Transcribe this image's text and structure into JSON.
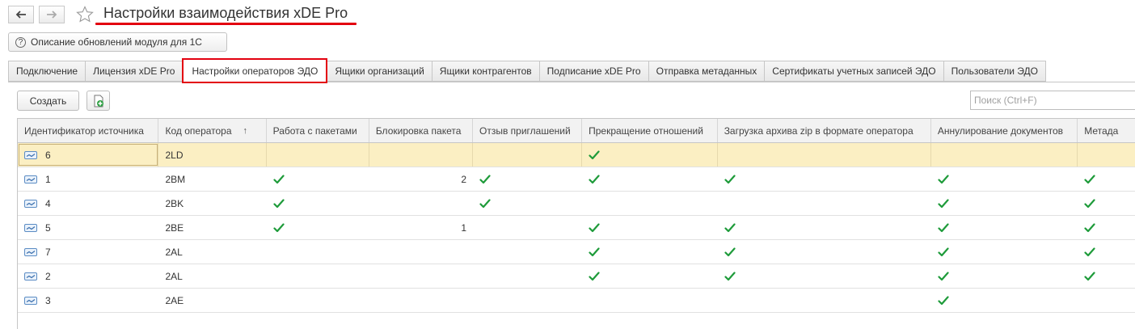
{
  "window": {
    "title": "Настройки взаимодействия xDE Pro",
    "nav": {
      "back_icon": "arrow-left-icon",
      "forward_icon": "arrow-right-icon",
      "favorite_icon": "star-icon"
    }
  },
  "toolbar": {
    "help_button_label": "Описание обновлений модуля для 1С"
  },
  "tabs": [
    {
      "label": "Подключение",
      "active": false
    },
    {
      "label": "Лицензия xDE Pro",
      "active": false
    },
    {
      "label": "Настройки операторов ЭДО",
      "active": true
    },
    {
      "label": "Ящики организаций",
      "active": false
    },
    {
      "label": "Ящики контрагентов",
      "active": false
    },
    {
      "label": "Подписание xDE Pro",
      "active": false
    },
    {
      "label": "Отправка метаданных",
      "active": false
    },
    {
      "label": "Сертификаты учетных записей ЭДО",
      "active": false
    },
    {
      "label": "Пользователи ЭДО",
      "active": false
    }
  ],
  "list_toolbar": {
    "create_label": "Создать",
    "copy_icon": "add-copy-icon",
    "search_placeholder": "Поиск (Ctrl+F)"
  },
  "table": {
    "columns": [
      "Идентификатор источника",
      "Код оператора",
      "Работа с пакетами",
      "Блокировка пакета",
      "Отзыв приглашений",
      "Прекращение отношений",
      "Загрузка архива zip в формате оператора",
      "Аннулирование документов",
      "Метада"
    ],
    "sort": {
      "column": "Код оператора",
      "direction": "ascending",
      "icon": "sort-up-arrow-icon"
    },
    "row_icon": "record-icon",
    "rows": [
      {
        "source_id": "6",
        "operator_code": "2LD",
        "packages": false,
        "lock": "",
        "invites": false,
        "terminate": true,
        "zip": false,
        "annul": false,
        "meta": false,
        "selected": true
      },
      {
        "source_id": "1",
        "operator_code": "2BM",
        "packages": true,
        "lock": "2",
        "invites": true,
        "terminate": true,
        "zip": true,
        "annul": true,
        "meta": true,
        "selected": false
      },
      {
        "source_id": "4",
        "operator_code": "2BK",
        "packages": true,
        "lock": "",
        "invites": true,
        "terminate": false,
        "zip": false,
        "annul": true,
        "meta": true,
        "selected": false
      },
      {
        "source_id": "5",
        "operator_code": "2BE",
        "packages": true,
        "lock": "1",
        "invites": false,
        "terminate": true,
        "zip": true,
        "annul": true,
        "meta": true,
        "selected": false
      },
      {
        "source_id": "7",
        "operator_code": "2AL",
        "packages": false,
        "lock": "",
        "invites": false,
        "terminate": true,
        "zip": true,
        "annul": true,
        "meta": true,
        "selected": false
      },
      {
        "source_id": "2",
        "operator_code": "2AL",
        "packages": false,
        "lock": "",
        "invites": false,
        "terminate": true,
        "zip": true,
        "annul": true,
        "meta": true,
        "selected": false
      },
      {
        "source_id": "3",
        "operator_code": "2AE",
        "packages": false,
        "lock": "",
        "invites": false,
        "terminate": false,
        "zip": false,
        "annul": true,
        "meta": false,
        "selected": false
      }
    ]
  },
  "colors": {
    "accent_red": "#e3000f",
    "check_green": "#1e9b3a",
    "selected_row": "#fbefc3",
    "header_bg": "#f2f2f2"
  }
}
